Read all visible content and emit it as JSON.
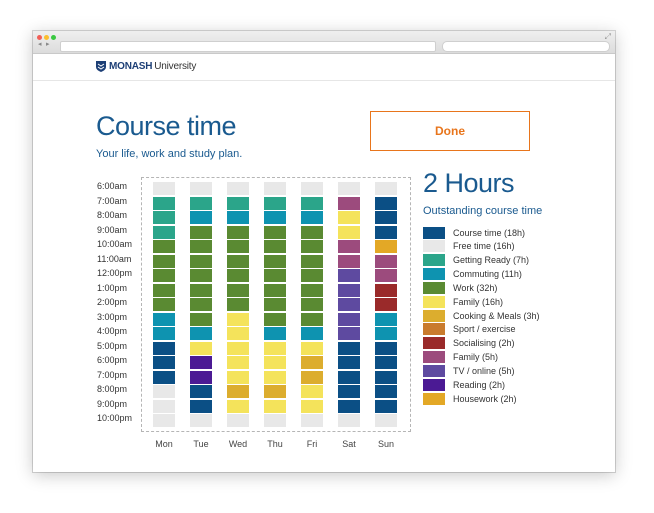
{
  "browser": {
    "dot_colors": [
      "#f25f58",
      "#fbbe2e",
      "#39c840"
    ],
    "back_glyph": "◂",
    "forward_glyph": "▸",
    "resize_glyph": "⤢"
  },
  "header": {
    "logo_bold": "MONASH",
    "logo_rest": "University"
  },
  "page": {
    "title": "Course time",
    "subtitle": "Your life, work and study plan.",
    "done_label": "Done"
  },
  "summary": {
    "hours": "2 Hours",
    "label": "Outstanding course time"
  },
  "colors": {
    "course": "#0b4f85",
    "free": "#e8e8e8",
    "ready": "#2ba58a",
    "commute": "#0e93b0",
    "work": "#5a8a32",
    "family": "#f4e35b",
    "cooking": "#dcad2e",
    "sport": "#c97b2d",
    "social": "#9a2a2a",
    "family2": "#9c4b7d",
    "tv": "#5e4aa0",
    "reading": "#4b1a94",
    "housework": "#e3a826"
  },
  "times": [
    "6:00am",
    "7:00am",
    "8:00am",
    "9:00am",
    "10:00am",
    "11:00am",
    "12:00pm",
    "1:00pm",
    "2:00pm",
    "3:00pm",
    "4:00pm",
    "5:00pm",
    "6:00pm",
    "7:00pm",
    "8:00pm",
    "9:00pm",
    "10:00pm"
  ],
  "days": [
    "Mon",
    "Tue",
    "Wed",
    "Thu",
    "Fri",
    "Sat",
    "Sun"
  ],
  "schedule": [
    [
      "free",
      "ready",
      "ready",
      "ready",
      "work",
      "work",
      "work",
      "work",
      "work",
      "commute",
      "commute",
      "course",
      "course",
      "course",
      "free",
      "free",
      "free"
    ],
    [
      "free",
      "ready",
      "commute",
      "work",
      "work",
      "work",
      "work",
      "work",
      "work",
      "work",
      "commute",
      "family",
      "reading",
      "reading",
      "course",
      "course",
      "free"
    ],
    [
      "free",
      "ready",
      "commute",
      "work",
      "work",
      "work",
      "work",
      "work",
      "work",
      "family",
      "family",
      "family",
      "family",
      "family",
      "cooking",
      "family",
      "free"
    ],
    [
      "free",
      "ready",
      "commute",
      "work",
      "work",
      "work",
      "work",
      "work",
      "work",
      "work",
      "commute",
      "family",
      "family",
      "family",
      "cooking",
      "family",
      "free"
    ],
    [
      "free",
      "ready",
      "commute",
      "work",
      "work",
      "work",
      "work",
      "work",
      "work",
      "work",
      "commute",
      "family",
      "cooking",
      "cooking",
      "family",
      "family",
      "free"
    ],
    [
      "free",
      "family2",
      "family",
      "family",
      "family2",
      "family2",
      "tv",
      "tv",
      "tv",
      "tv",
      "tv",
      "course",
      "course",
      "course",
      "course",
      "course",
      "free"
    ],
    [
      "free",
      "course",
      "course",
      "course",
      "housework",
      "family2",
      "family2",
      "social",
      "social",
      "commute",
      "commute",
      "course",
      "course",
      "course",
      "course",
      "course",
      "free"
    ]
  ],
  "legend": [
    {
      "key": "course",
      "label": "Course time (18h)"
    },
    {
      "key": "free",
      "label": "Free time (16h)"
    },
    {
      "key": "ready",
      "label": "Getting Ready (7h)"
    },
    {
      "key": "commute",
      "label": "Commuting (11h)"
    },
    {
      "key": "work",
      "label": "Work (32h)"
    },
    {
      "key": "family",
      "label": "Family (16h)"
    },
    {
      "key": "cooking",
      "label": "Cooking & Meals (3h)"
    },
    {
      "key": "sport",
      "label": "Sport / exercise"
    },
    {
      "key": "social",
      "label": "Socialising (2h)"
    },
    {
      "key": "family2",
      "label": "Family (5h)"
    },
    {
      "key": "tv",
      "label": "TV / online (5h)"
    },
    {
      "key": "reading",
      "label": "Reading (2h)"
    },
    {
      "key": "housework",
      "label": "Housework (2h)"
    }
  ]
}
